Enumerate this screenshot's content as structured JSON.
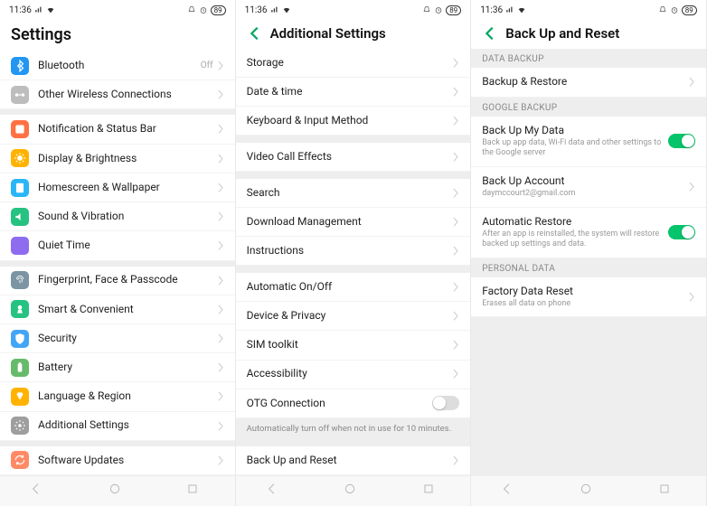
{
  "statusbar": {
    "time": "11:36",
    "battery": "89"
  },
  "screens": [
    {
      "id": "settings",
      "headerType": "main",
      "title": "Settings",
      "groups": [
        {
          "items": [
            {
              "icon": "bluetooth",
              "color": "#2196f3",
              "title": "Bluetooth",
              "value": "Off",
              "chevron": true
            },
            {
              "icon": "wireless",
              "color": "#bdbdbd",
              "title": "Other Wireless Connections",
              "chevron": true
            }
          ]
        },
        {
          "items": [
            {
              "icon": "notif",
              "color": "#ff7043",
              "title": "Notification & Status Bar",
              "chevron": true
            },
            {
              "icon": "display",
              "color": "#ffb300",
              "title": "Display & Brightness",
              "chevron": true
            },
            {
              "icon": "home",
              "color": "#29b6f6",
              "title": "Homescreen & Wallpaper",
              "chevron": true
            },
            {
              "icon": "sound",
              "color": "#26c281",
              "title": "Sound & Vibration",
              "chevron": true
            },
            {
              "icon": "quiet",
              "color": "#8e6cef",
              "title": "Quiet Time",
              "chevron": true
            }
          ]
        },
        {
          "items": [
            {
              "icon": "fingerprint",
              "color": "#7b95a3",
              "title": "Fingerprint, Face & Passcode",
              "chevron": true
            },
            {
              "icon": "smart",
              "color": "#26c281",
              "title": "Smart & Convenient",
              "chevron": true
            },
            {
              "icon": "security",
              "color": "#42a5f5",
              "title": "Security",
              "chevron": true
            },
            {
              "icon": "battery",
              "color": "#66bb6a",
              "title": "Battery",
              "chevron": true
            },
            {
              "icon": "language",
              "color": "#ffb300",
              "title": "Language & Region",
              "chevron": true
            },
            {
              "icon": "gear",
              "color": "#9e9e9e",
              "title": "Additional Settings",
              "chevron": true
            }
          ]
        },
        {
          "items": [
            {
              "icon": "update",
              "color": "#ff8a65",
              "title": "Software Updates",
              "chevron": true
            }
          ]
        }
      ]
    },
    {
      "id": "additional",
      "headerType": "sub",
      "title": "Additional Settings",
      "groups": [
        {
          "items": [
            {
              "title": "Storage",
              "chevron": true
            },
            {
              "title": "Date & time",
              "chevron": true
            },
            {
              "title": "Keyboard & Input Method",
              "chevron": true
            }
          ]
        },
        {
          "items": [
            {
              "title": "Video Call Effects",
              "chevron": true
            }
          ]
        },
        {
          "items": [
            {
              "title": "Search",
              "chevron": true
            },
            {
              "title": "Download Management",
              "chevron": true
            },
            {
              "title": "Instructions",
              "chevron": true
            }
          ]
        },
        {
          "items": [
            {
              "title": "Automatic On/Off",
              "chevron": true
            },
            {
              "title": "Device & Privacy",
              "chevron": true
            },
            {
              "title": "SIM toolkit",
              "chevron": true
            },
            {
              "title": "Accessibility",
              "chevron": true
            },
            {
              "title": "OTG Connection",
              "toggle": "off"
            }
          ],
          "note": "Automatically turn off when not in use for 10 minutes."
        },
        {
          "items": [
            {
              "title": "Back Up and Reset",
              "chevron": true
            }
          ]
        }
      ]
    },
    {
      "id": "backup",
      "headerType": "sub",
      "title": "Back Up and Reset",
      "groups": [
        {
          "head": "DATA BACKUP",
          "items": [
            {
              "title": "Backup & Restore",
              "chevron": true
            }
          ]
        },
        {
          "head": "GOOGLE BACKUP",
          "items": [
            {
              "title": "Back Up My Data",
              "sub": "Back up app data, Wi-Fi data and other settings to the Google server",
              "toggle": "on"
            },
            {
              "title": "Back Up Account",
              "sub": "daymccourt2@gmail.com",
              "chevron": true
            },
            {
              "title": "Automatic Restore",
              "sub": "After an app is reinstalled, the system will restore backed up settings and data.",
              "toggle": "on"
            }
          ]
        },
        {
          "head": "PERSONAL DATA",
          "items": [
            {
              "title": "Factory Data Reset",
              "sub": "Erases all data on phone",
              "chevron": true
            }
          ]
        }
      ],
      "filler": true
    }
  ]
}
